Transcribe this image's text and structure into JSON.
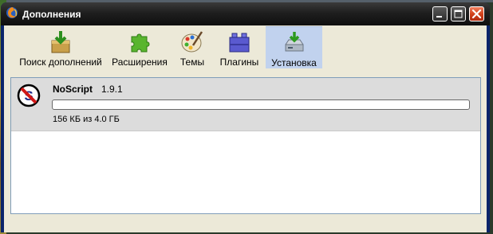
{
  "window": {
    "title": "Дополнения",
    "icon": "firefox-icon"
  },
  "toolbar": {
    "items": [
      {
        "label": "Поиск дополнений",
        "icon": "get-addons-icon",
        "active": false
      },
      {
        "label": "Расширения",
        "icon": "extensions-puzzle-icon",
        "active": false
      },
      {
        "label": "Темы",
        "icon": "themes-palette-icon",
        "active": false
      },
      {
        "label": "Плагины",
        "icon": "plugins-blocks-icon",
        "active": false
      },
      {
        "label": "Установка",
        "icon": "install-drive-icon",
        "active": true
      }
    ]
  },
  "install_list": {
    "items": [
      {
        "name": "NoScript",
        "version": "1.9.1",
        "icon": "noscript-icon",
        "progress": 0,
        "status": "156 КБ из 4.0 ГБ"
      }
    ]
  },
  "colors": {
    "titlebar": "#1f1f1f",
    "active_tab": "#c1d2ee",
    "close_button": "#d3421c",
    "item_background": "#dcdcdc"
  }
}
